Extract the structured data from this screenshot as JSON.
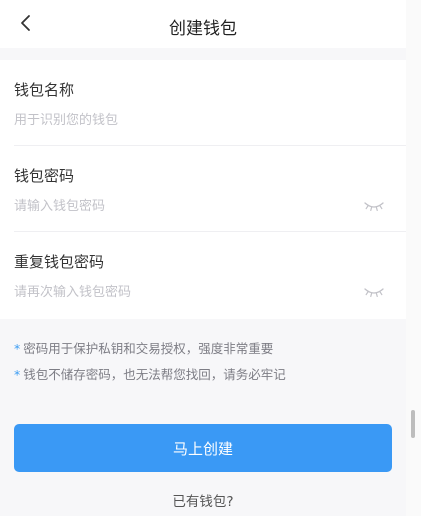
{
  "header": {
    "title": "创建钱包",
    "back_icon": "chevron-left-icon"
  },
  "form": {
    "wallet_name": {
      "label": "钱包名称",
      "placeholder": "用于识别您的钱包",
      "value": ""
    },
    "password": {
      "label": "钱包密码",
      "placeholder": "请输入钱包密码",
      "value": "",
      "toggle_icon": "eye-closed-icon"
    },
    "repeat_password": {
      "label": "重复钱包密码",
      "placeholder": "请再次输入钱包密码",
      "value": "",
      "toggle_icon": "eye-closed-icon"
    }
  },
  "notes": [
    {
      "bullet": "*",
      "text": "密码用于保护私钥和交易授权，强度非常重要"
    },
    {
      "bullet": "*",
      "text": "钱包不储存密码，也无法帮您找回，请务必牢记"
    }
  ],
  "actions": {
    "create_label": "马上创建",
    "already_have_label": "已有钱包?"
  },
  "colors": {
    "accent": "#3a99f5",
    "background": "#f7f7f9",
    "placeholder": "#c2c2c8",
    "note_text": "#7d7d85"
  }
}
